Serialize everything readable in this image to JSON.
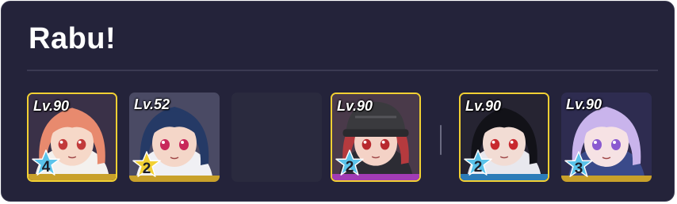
{
  "title": "Rabu!",
  "team1": [
    {
      "level": "Lv.90",
      "stars": "4",
      "star_color": "#5bc3ea",
      "bar_color": "#c9a12a",
      "hair": "#e88a6e",
      "skin": "#f6d8c8",
      "eye": "#c23a3a",
      "bg": "#3a3148",
      "outfit": "#f4f1ee"
    },
    {
      "level": "Lv.52",
      "stars": "2",
      "star_color": "#f2d033",
      "bar_color": "#c9a12a",
      "hair": "#253a66",
      "skin": "#f4d6c8",
      "eye": "#c8285a",
      "bg": "#4a4a64",
      "outfit": "#f0f0f4"
    },
    {
      "empty": true
    },
    {
      "level": "Lv.90",
      "stars": "2",
      "star_color": "#5bc3ea",
      "bar_color": "#a23cb5",
      "hair": "#b53a3e",
      "skin": "#f4d2c6",
      "eye": "#b8282e",
      "bg": "#4a3a4a",
      "outfit": "#2c2c34",
      "cap": "#3a3a3e"
    }
  ],
  "team2": [
    {
      "level": "Lv.90",
      "stars": "2",
      "star_color": "#5bc3ea",
      "bar_color": "#2c7cb8",
      "hair": "#121218",
      "skin": "#f2dcd4",
      "eye": "#c8282e",
      "bg": "#262432",
      "outfit": "#e8e8ee"
    },
    {
      "level": "Lv.90",
      "stars": "3",
      "star_color": "#5bc3ea",
      "bar_color": "#c9a12a",
      "hair": "#c9b4ec",
      "skin": "#f6e2e4",
      "eye": "#8a5ad0",
      "bg": "#2e2c50",
      "outfit": "#3a4a8a"
    }
  ]
}
